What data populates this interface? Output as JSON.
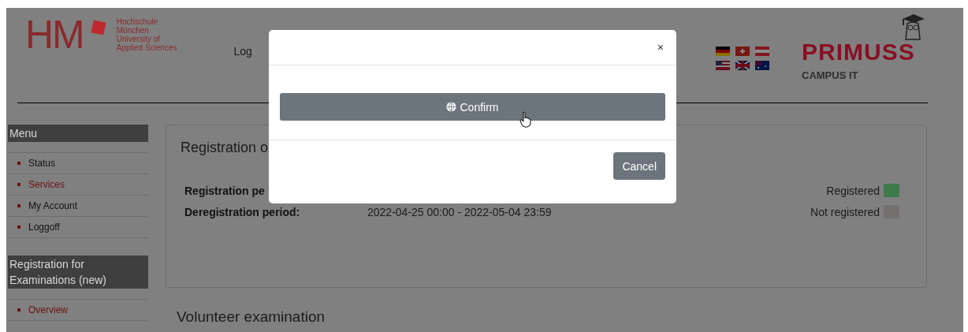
{
  "header": {
    "logo": {
      "mark": "HM",
      "lines": [
        "Hochschule",
        "München",
        "University of",
        "Applied Sciences"
      ]
    },
    "user_text": "Log",
    "brand": {
      "name": "PRIMUSS",
      "tagline": "CAMPUS IT"
    }
  },
  "sidebar": {
    "sections": [
      {
        "title": "Menu",
        "items": [
          {
            "label": "Status",
            "selected": false
          },
          {
            "label": "Services",
            "selected": true
          },
          {
            "label": "My Account",
            "selected": false
          },
          {
            "label": "Loggoff",
            "selected": false
          }
        ]
      },
      {
        "title": "Registration for Examinations (new)",
        "items": [
          {
            "label": "Overview",
            "selected": true
          }
        ]
      }
    ]
  },
  "panel": {
    "title": "Registration o",
    "rows": [
      {
        "label": "Registration pe"
      },
      {
        "label": "Deregistration period:",
        "value": "2022-04-25 00:00 - 2022-05-04 23:59"
      }
    ],
    "legend": [
      {
        "label": "Registered",
        "color": "#3f7a4a"
      },
      {
        "label": "Not registered",
        "color": "#747070"
      }
    ]
  },
  "section_heading": "Volunteer examination",
  "modal": {
    "close": "×",
    "confirm": "Confirm",
    "cancel": "Cancel"
  }
}
